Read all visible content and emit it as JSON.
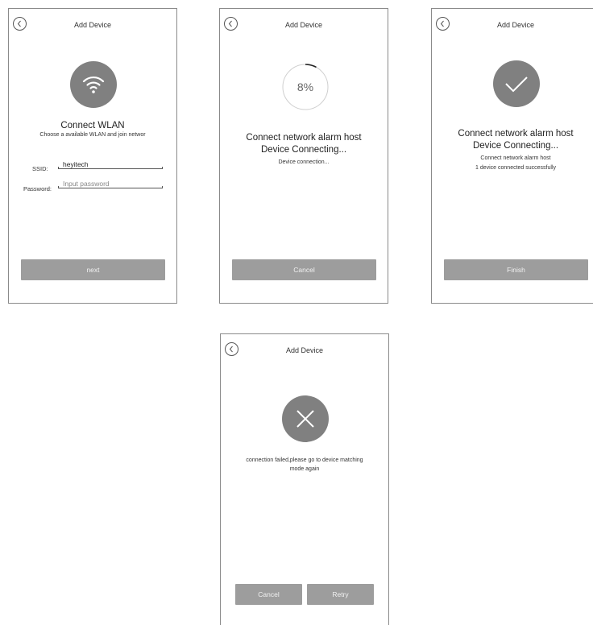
{
  "screens": {
    "connect": {
      "title": "Add Device",
      "heading": "Connect WLAN",
      "subtext": "Choose a available WLAN and join networ",
      "ssid_label": "SSID:",
      "ssid_value": "heyitech",
      "password_label": "Password:",
      "password_placeholder": "Input password",
      "next_label": "next",
      "icon": "wifi-icon"
    },
    "progress": {
      "title": "Add Device",
      "percent": 8,
      "percent_label": "8%",
      "heading_line1": "Connect network alarm host",
      "heading_line2": "Device Connecting...",
      "status": "Device connection...",
      "cancel_label": "Cancel"
    },
    "success": {
      "title": "Add Device",
      "heading_line1": "Connect network alarm host",
      "heading_line2": "Device Connecting...",
      "line1": "Connect network alarm host",
      "line2": "1 device connected successfully",
      "finish_label": "Finish",
      "icon": "checkmark-icon"
    },
    "failed": {
      "title": "Add Device",
      "message_line1": "connection failed,please go to device matching",
      "message_line2": "mode again",
      "cancel_label": "Cancel",
      "retry_label": "Retry",
      "icon": "close-x-icon"
    }
  },
  "colors": {
    "icon_circle": "#808080",
    "button": "#9d9d9d",
    "button_text": "#f2f2f2",
    "progress_arc": "#222222",
    "progress_track": "#cfcfcf"
  }
}
